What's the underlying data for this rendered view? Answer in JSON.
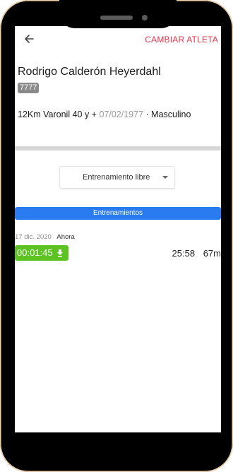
{
  "header": {
    "change_athlete_label": "CAMBIAR ATLETA"
  },
  "athlete": {
    "name": "Rodrigo Calderón Heyerdahl",
    "bib": "7777",
    "category": "12Km Varonil 40 y +",
    "birthdate": "07/02/1977",
    "separator": "·",
    "gender": "Masculino"
  },
  "selector": {
    "value": "Entrenamiento libre"
  },
  "section": {
    "title": "Entrenamientos"
  },
  "entries": [
    {
      "date": "17 dic. 2020",
      "status": "Ahora",
      "time": "00:01:45",
      "pace": "25:58",
      "distance": "67m"
    }
  ],
  "colors": {
    "accent_red": "#e8344a",
    "primary_blue": "#2b7bf0",
    "success_green": "#5cc323"
  },
  "icons": {
    "back": "arrow-left-icon",
    "dropdown": "caret-down-icon",
    "time_badge": "flag-icon"
  }
}
